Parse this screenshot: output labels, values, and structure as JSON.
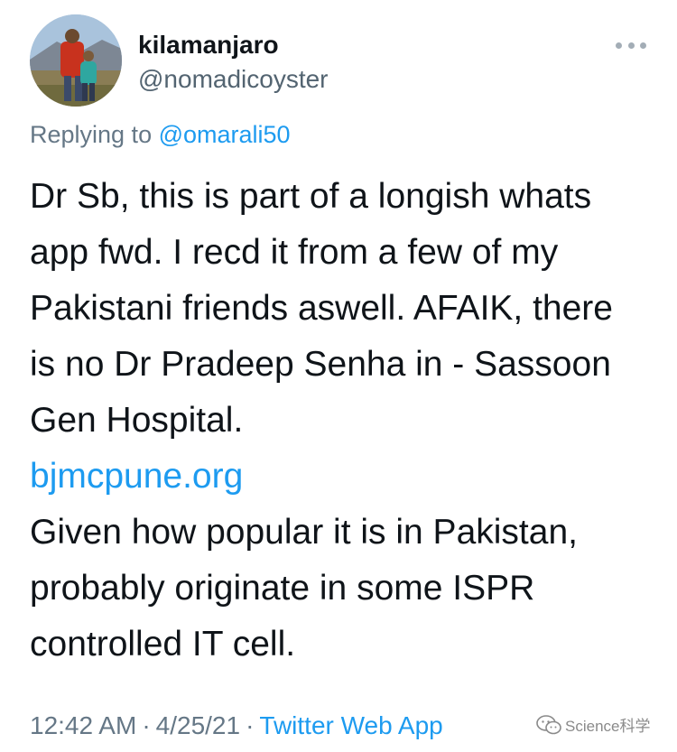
{
  "tweet": {
    "display_name": "kilamanjaro",
    "handle": "@nomadicoyster",
    "reply_prefix": "Replying to",
    "reply_to": "@omarali50",
    "body": {
      "para1_lines": [
        "Dr Sb, this is part of a longish whats",
        "app fwd. I recd it from a few of my",
        "Pakistani friends aswell. AFAIK, there",
        "is no Dr Pradeep Senha in - Sassoon",
        "Gen Hospital."
      ],
      "link": "bjmcpune.org",
      "para2_lines": [
        "Given how popular it is in Pakistan,",
        "probably originate in some ISPR",
        "controlled IT cell."
      ]
    },
    "time": "12:42 AM",
    "date": "4/25/21",
    "separator": "·",
    "source": "Twitter Web App"
  },
  "watermark": {
    "text": "Science科学",
    "icon": "wechat-icon"
  },
  "icons": {
    "more": "more-icon",
    "avatar": "avatar-photo"
  },
  "colors": {
    "link": "#1d9bf0",
    "secondary_text": "#657786",
    "primary_text": "#0f1419"
  }
}
